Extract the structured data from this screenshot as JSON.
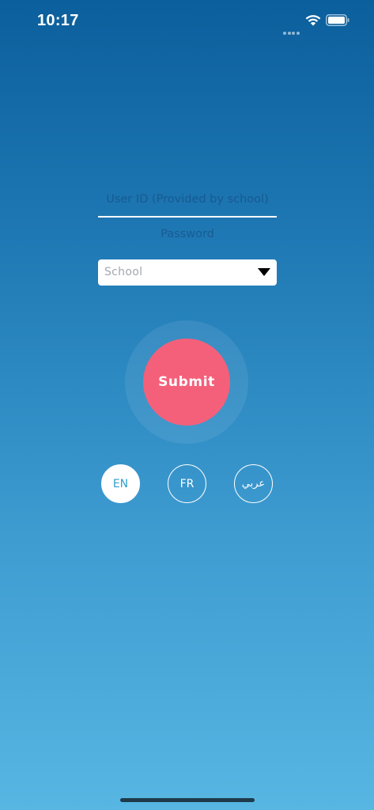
{
  "status_bar": {
    "time": "10:17",
    "icons": [
      "signal-dots-icon",
      "wifi-icon",
      "battery-icon"
    ]
  },
  "login_form": {
    "user_id": {
      "value": "",
      "placeholder": "User ID (Provided by school)"
    },
    "password": {
      "value": "",
      "placeholder": "Password"
    },
    "school": {
      "selected": "School"
    }
  },
  "submit": {
    "label": "Submit"
  },
  "languages": [
    {
      "label": "EN",
      "selected": true
    },
    {
      "label": "FR",
      "selected": false
    },
    {
      "label": "عربي",
      "selected": false
    }
  ],
  "colors": {
    "background_top": "#0b5f9c",
    "background_bottom": "#57b6e2",
    "submit": "#f4607a",
    "selected_language_text": "#2f9fcf"
  }
}
